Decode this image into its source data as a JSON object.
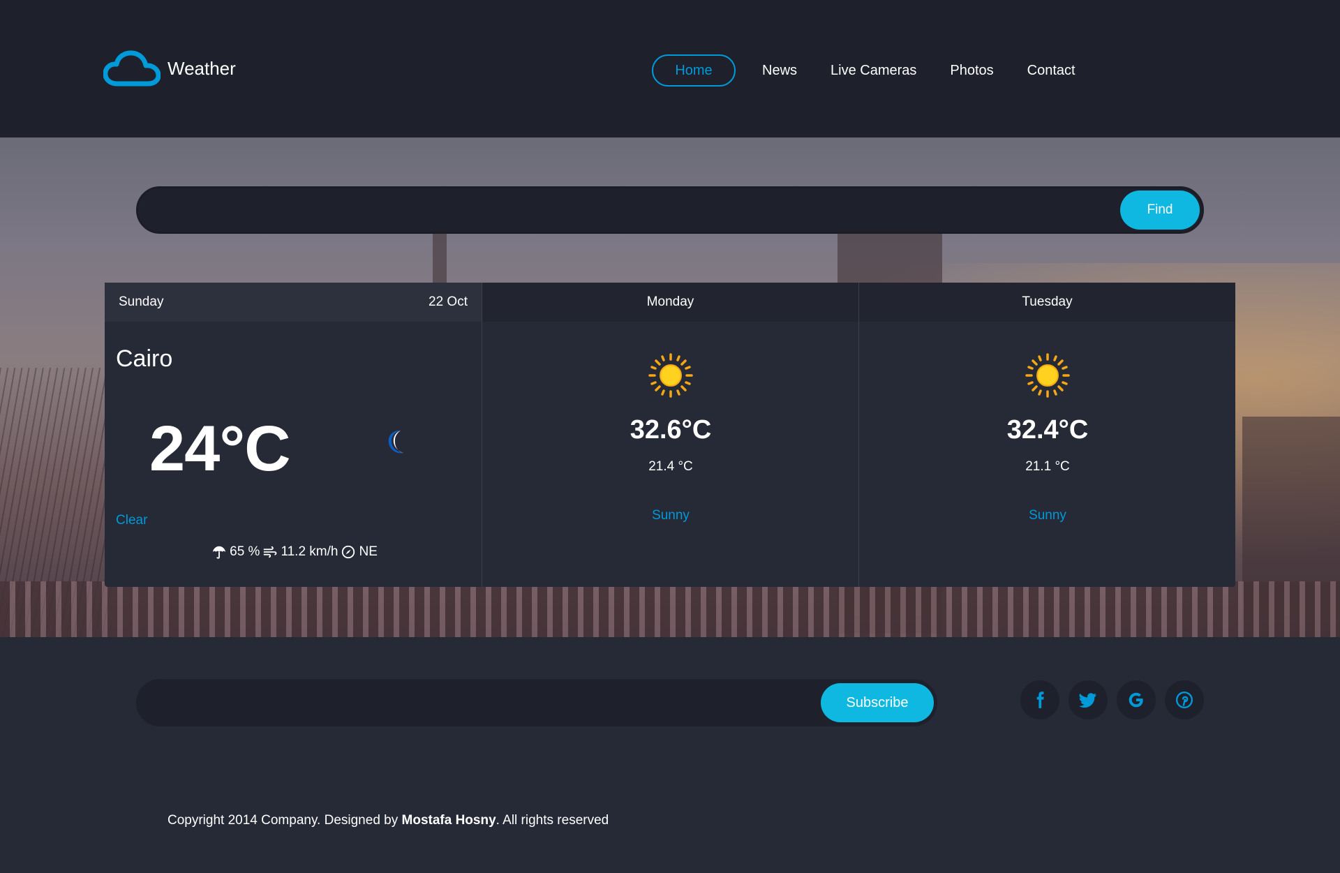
{
  "header": {
    "logo_text": "Weather",
    "nav": [
      {
        "label": "Home",
        "active": true
      },
      {
        "label": "News",
        "active": false
      },
      {
        "label": "Live Cameras",
        "active": false
      },
      {
        "label": "Photos",
        "active": false
      },
      {
        "label": "Contact",
        "active": false
      }
    ]
  },
  "search": {
    "placeholder": "",
    "value": "",
    "button_label": "Find"
  },
  "forecast": {
    "today": {
      "day": "Sunday",
      "date": "22 Oct",
      "city": "Cairo",
      "temp": "24°C",
      "icon": "moon-icon",
      "condition": "Clear",
      "humidity": "65 %",
      "wind_speed": "11.2 km/h",
      "wind_dir": "NE"
    },
    "days": [
      {
        "day": "Monday",
        "icon": "sun-icon",
        "max": "32.6°C",
        "min": "21.4 °C",
        "condition": "Sunny"
      },
      {
        "day": "Tuesday",
        "icon": "sun-icon",
        "max": "32.4°C",
        "min": "21.1 °C",
        "condition": "Sunny"
      }
    ]
  },
  "subscribe": {
    "placeholder": "",
    "button_label": "Subscribe"
  },
  "socials": [
    "facebook-icon",
    "twitter-icon",
    "google-icon",
    "pinterest-icon"
  ],
  "footer": {
    "copyright_prefix": "Copyright 2014 Company. Designed by ",
    "designer": "Mostafa Hosny",
    "copyright_suffix": ". All rights reserved"
  },
  "colors": {
    "accent": "#009ad8",
    "button": "#0fb8e0",
    "header_bg": "#1e202b",
    "body_bg": "#262936"
  }
}
